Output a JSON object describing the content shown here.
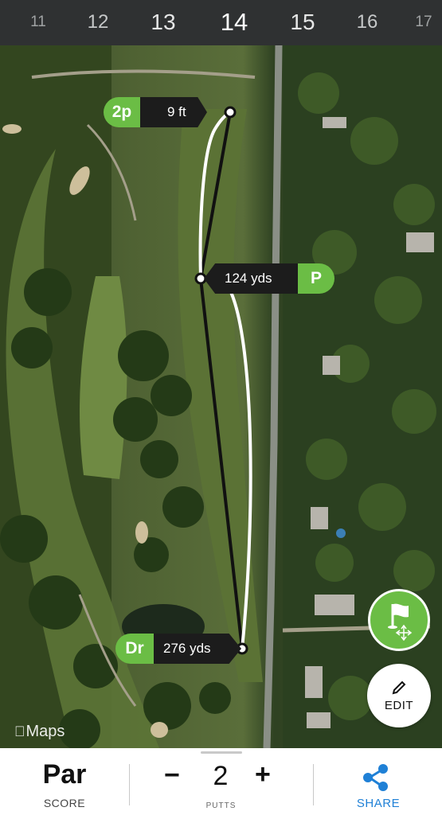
{
  "holes": [
    {
      "number": "11",
      "state": "far"
    },
    {
      "number": "12",
      "state": "near"
    },
    {
      "number": "13",
      "state": "adjacent"
    },
    {
      "number": "14",
      "state": "current"
    },
    {
      "number": "15",
      "state": "adjacent"
    },
    {
      "number": "16",
      "state": "near"
    },
    {
      "number": "17",
      "state": "far"
    }
  ],
  "shots": {
    "putt": {
      "club": "2p",
      "distance": "9 ft"
    },
    "approach": {
      "club": "P",
      "distance": "124 yds"
    },
    "drive": {
      "club": "Dr",
      "distance": "276 yds"
    }
  },
  "map": {
    "attribution": "Maps",
    "attribution_icon": "apple-logo-icon"
  },
  "buttons": {
    "flag_icon": "flag-move-icon",
    "edit_label": "EDIT",
    "edit_icon": "pencil-icon"
  },
  "bottom_bar": {
    "score_value": "Par",
    "score_label": "SCORE",
    "putts_minus": "−",
    "putts_value": "2",
    "putts_plus": "+",
    "putts_label": "PUTTS",
    "share_label": "SHARE",
    "share_icon": "share-icon"
  },
  "colors": {
    "accent_green": "#6bbd45",
    "share_blue": "#1f80d6",
    "top_bar": "#2f3132"
  }
}
